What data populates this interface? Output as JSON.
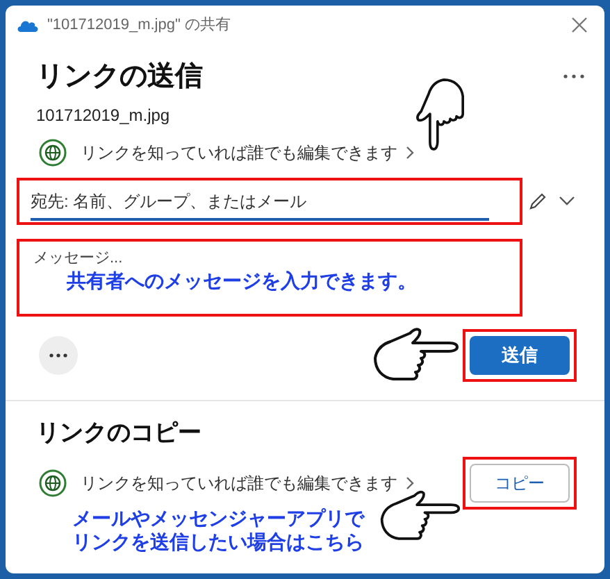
{
  "window": {
    "title": "\"101712019_m.jpg\" の共有"
  },
  "send_section": {
    "heading": "リンクの送信",
    "filename": "101712019_m.jpg",
    "permission": "リンクを知っていれば誰でも編集できます",
    "to_field": {
      "placeholder": "宛先: 名前、グループ、またはメール"
    },
    "message_field": {
      "placeholder": "メッセージ..."
    },
    "send_button": "送信"
  },
  "copy_section": {
    "heading": "リンクのコピー",
    "permission": "リンクを知っていれば誰でも編集できます",
    "copy_button": "コピー"
  },
  "annotations": [
    {
      "lines": [
        "共有者へのメッセージを入力できます。"
      ]
    },
    {
      "lines": [
        "メールやメッセンジャーアプリで",
        "リンクを送信したい場合はこちら"
      ]
    }
  ]
}
